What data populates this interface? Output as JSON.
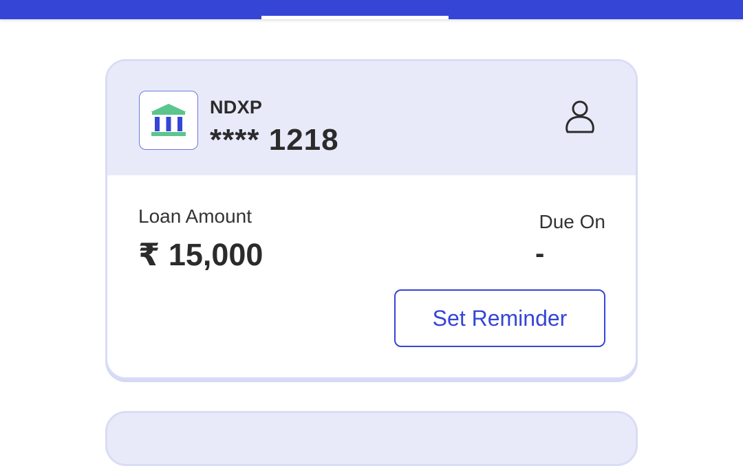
{
  "loan_card": {
    "bank_name": "NDXP",
    "account_number": "**** 1218",
    "loan_amount_label": "Loan Amount",
    "loan_amount": "₹ 15,000",
    "due_label": "Due On",
    "due_value": "-",
    "reminder_button": "Set Reminder",
    "bank_icon": "bank-icon",
    "profile_icon": "user-icon"
  },
  "colors": {
    "primary": "#3545d6",
    "card_header": "#e9eaf9",
    "bank_green": "#5cc58e",
    "bank_blue": "#3545d6"
  }
}
